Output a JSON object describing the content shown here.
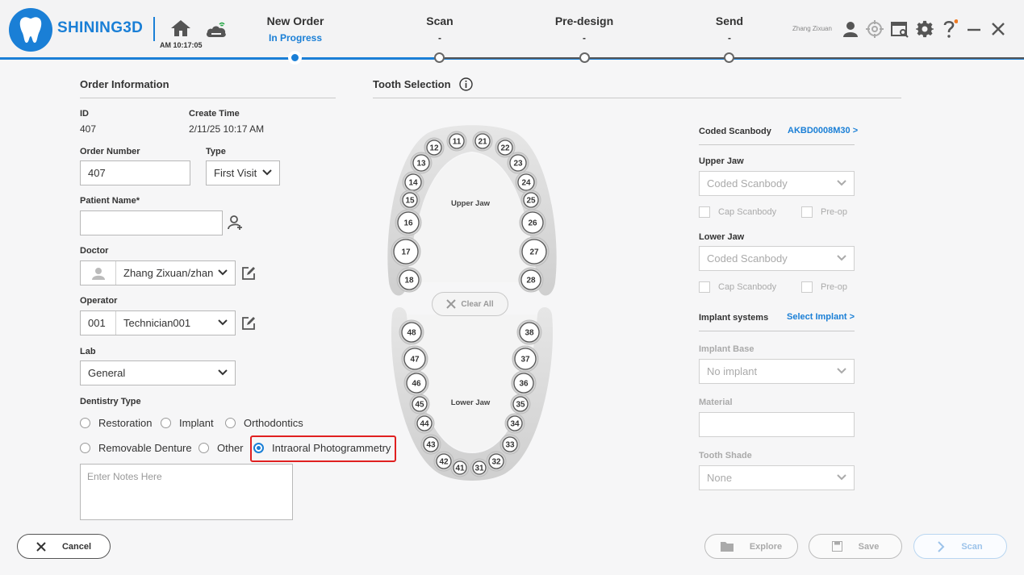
{
  "app": {
    "brand": "SHINING3D",
    "clock": "AM 10:17:05",
    "user": "Zhang Zixuan"
  },
  "steps": [
    {
      "label": "New Order",
      "status": "In Progress"
    },
    {
      "label": "Scan",
      "status": "-"
    },
    {
      "label": "Pre-design",
      "status": "-"
    },
    {
      "label": "Send",
      "status": "-"
    }
  ],
  "order": {
    "title": "Order Information",
    "id_label": "ID",
    "id_value": "407",
    "create_label": "Create Time",
    "create_value": "2/11/25 10:17 AM",
    "number_label": "Order Number",
    "number_value": "407",
    "type_label": "Type",
    "type_value": "First Visit",
    "patient_label": "Patient Name*",
    "patient_value": "",
    "doctor_label": "Doctor",
    "doctor_value": "Zhang Zixuan/zhan",
    "operator_label": "Operator",
    "operator_id": "001",
    "operator_value": "Technician001",
    "lab_label": "Lab",
    "lab_value": "General",
    "dentistry_label": "Dentistry Type",
    "dentistry_options": [
      "Restoration",
      "Implant",
      "Orthodontics",
      "Removable Denture",
      "Other",
      "Intraoral Photogrammetry"
    ],
    "dentistry_selected": "Intraoral Photogrammetry",
    "notes_placeholder": "Enter Notes Here"
  },
  "tooth": {
    "title": "Tooth Selection",
    "upper_label": "Upper Jaw",
    "lower_label": "Lower Jaw",
    "clear_all": "Clear All",
    "teeth": [
      "11",
      "12",
      "13",
      "14",
      "15",
      "16",
      "17",
      "18",
      "21",
      "22",
      "23",
      "24",
      "25",
      "26",
      "27",
      "28",
      "31",
      "32",
      "33",
      "34",
      "35",
      "36",
      "37",
      "38",
      "41",
      "42",
      "43",
      "44",
      "45",
      "46",
      "47",
      "48"
    ]
  },
  "side": {
    "coded_label": "Coded Scanbody",
    "coded_link": "AKBD0008M30 >",
    "upper_label": "Upper Jaw",
    "upper_value": "Coded Scanbody",
    "lower_label": "Lower Jaw",
    "lower_value": "Coded Scanbody",
    "cap_label": "Cap Scanbody",
    "preop_label": "Pre-op",
    "implant_label": "Implant systems",
    "implant_link": "Select Implant >",
    "base_label": "Implant Base",
    "base_value": "No implant",
    "material_label": "Material",
    "material_value": "",
    "shade_label": "Tooth Shade",
    "shade_value": "None"
  },
  "buttons": {
    "cancel": "Cancel",
    "explore": "Explore",
    "save": "Save",
    "scan": "Scan"
  },
  "colors": {
    "accent": "#1a7fd6",
    "highlight": "#e02020"
  }
}
